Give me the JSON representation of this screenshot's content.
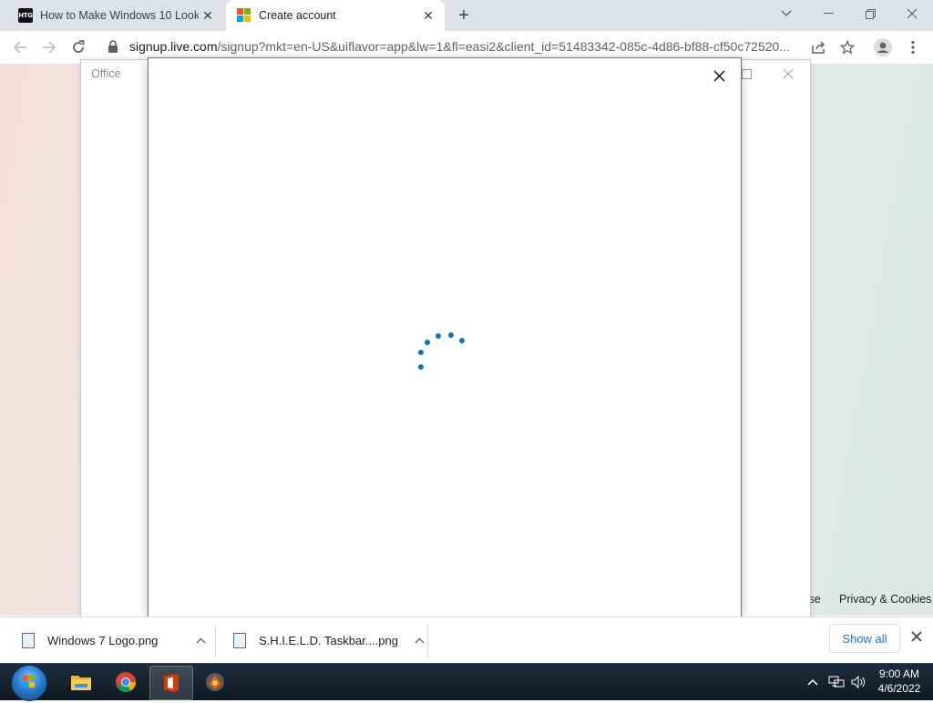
{
  "browser": {
    "tabs": [
      {
        "title": "How to Make Windows 10 Look",
        "favicon": "htg-icon",
        "favicon_text": "HTG",
        "active": false
      },
      {
        "title": "Create account",
        "favicon": "microsoft-logo-icon",
        "active": true
      }
    ],
    "new_tab_symbol": "+",
    "url_host": "signup.live.com",
    "url_path": "/signup?mkt=en-US&uiflavor=app&lw=1&fl=easi2&client_id=51483342-085c-4d86-bf88-cf50c72520..."
  },
  "office_window": {
    "title": "Office"
  },
  "page_footer": {
    "partial_link": "Ise",
    "privacy_link": "Privacy & Cookies"
  },
  "modal": {
    "state": "loading",
    "spinner_color": "#0b72c9"
  },
  "downloads": {
    "items": [
      {
        "name": "Windows 7 Logo.png"
      },
      {
        "name": "S.H.I.E.L.D. Taskbar....png"
      }
    ],
    "show_all": "Show all"
  },
  "taskbar": {
    "pinned": [
      "start-orb",
      "file-explorer-icon",
      "chrome-icon",
      "office-icon",
      "app-icon"
    ],
    "time": "9:00 AM",
    "date": "4/6/2022"
  },
  "colors": {
    "tab_strip": "#dee1e6",
    "accent_blue": "#1a73e8",
    "taskbar": "#16212c"
  }
}
